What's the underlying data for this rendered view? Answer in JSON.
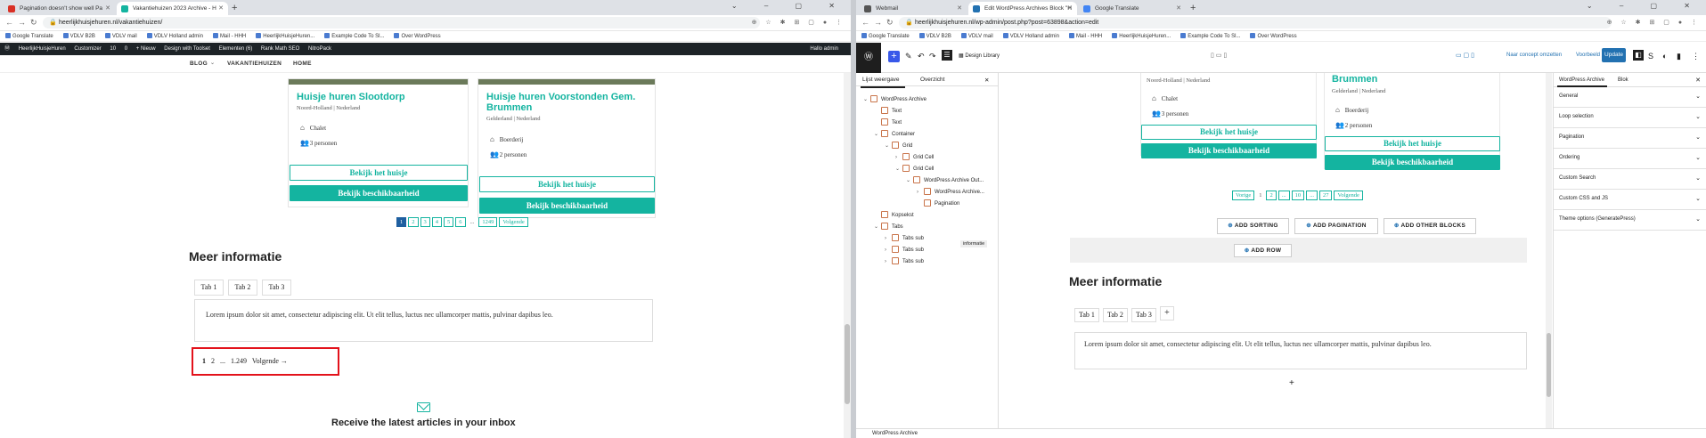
{
  "left": {
    "tabs": [
      {
        "title": "Pagination doesn't show well Pa",
        "color": "#d93025"
      },
      {
        "title": "Vakantiehuizen 2023 Archive - H",
        "color": "#14b4a0"
      }
    ],
    "url": "heerlijkhuisjehuren.nl/vakantiehuizen/",
    "bookmarks": [
      "Google Translate",
      "VDLV B2B",
      "VDLV mail",
      "VDLV Holland admin",
      "Mail - HHH",
      "HeerlijkHuisjeHuren...",
      "Example Code To Sl...",
      "Over WordPress"
    ],
    "adminbar": {
      "items": [
        "HeerlijkHuisjeHuren",
        "Customizer",
        "10",
        "0",
        "+ Nieuw",
        "Design with Toolset",
        "Elementen (6)",
        "Rank Math SEO",
        "NitroPack"
      ],
      "right": "Hallo admin"
    },
    "nav": {
      "blog": "BLOG",
      "vakantiehuizen": "VAKANTIEHUIZEN",
      "home": "HOME"
    },
    "cards": [
      {
        "title": "Huisje huren Slootdorp",
        "location": "Noord-Holland | Nederland",
        "type": "Chalet",
        "persons": "3 personen",
        "btn_house": "Bekijk het huisje",
        "btn_avail": "Bekijk beschikbaarheid"
      },
      {
        "title": "Huisje huren Voorstonden Gem. Brummen",
        "location": "Gelderland | Nederland",
        "type": "Boerderij",
        "persons": "2 personen",
        "btn_house": "Bekijk het huisje",
        "btn_avail": "Bekijk beschikbaarheid"
      }
    ],
    "pagination": [
      "1",
      "2",
      "3",
      "4",
      "5",
      "6",
      "...",
      "1249",
      "Volgende"
    ],
    "meer_info": "Meer informatie",
    "tab_labels": [
      "Tab 1",
      "Tab 2",
      "Tab 3"
    ],
    "lorem": "Lorem ipsum dolor sit amet, consectetur adipiscing elit. Ut elit tellus, luctus nec ullamcorper mattis, pulvinar dapibus leo.",
    "wp_pagination": [
      "1",
      "2",
      "...",
      "1.249",
      "Volgende →"
    ],
    "subscribe": "Receive the latest articles in your inbox"
  },
  "right": {
    "tabs": [
      {
        "title": "Webmail",
        "color": "#555"
      },
      {
        "title": "Edit WordPress Archives Block \"H",
        "color": "#2271b1"
      },
      {
        "title": "Google Translate",
        "color": "#4285f4"
      }
    ],
    "url": "heerlijkhuisjehuren.nl/wp-admin/post.php?post=63898&action=edit",
    "bookmarks": [
      "Google Translate",
      "VDLV B2B",
      "VDLV mail",
      "VDLV Holland admin",
      "Mail - HHH",
      "HeerlijkHuisjeHuren...",
      "Example Code To Sl...",
      "Over WordPress"
    ],
    "toolbar": {
      "design_library": "Design Library",
      "save_draft": "Naar concept omzetten",
      "preview": "Voorbeeld",
      "update": "Update"
    },
    "listview": {
      "tab1": "Lijst weergave",
      "tab2": "Overzicht",
      "rows": [
        {
          "label": "WordPress Archive",
          "indent": 0,
          "chev": "⌄"
        },
        {
          "label": "Text",
          "indent": 1,
          "chev": ""
        },
        {
          "label": "Text",
          "indent": 1,
          "chev": ""
        },
        {
          "label": "Container",
          "indent": 1,
          "chev": "⌄"
        },
        {
          "label": "Grid",
          "indent": 2,
          "chev": "⌄"
        },
        {
          "label": "Grid Cell",
          "indent": 3,
          "chev": "›"
        },
        {
          "label": "Grid Cell",
          "indent": 3,
          "chev": "⌄"
        },
        {
          "label": "WordPress Archive Out...",
          "indent": 4,
          "chev": "⌄"
        },
        {
          "label": "WordPress Archive...",
          "indent": 5,
          "chev": "›"
        },
        {
          "label": "Pagination",
          "indent": 5,
          "chev": ""
        },
        {
          "label": "Kopsekst",
          "indent": 1,
          "chev": ""
        },
        {
          "label": "Tabs",
          "indent": 1,
          "chev": "⌄"
        },
        {
          "label": "Tabs sub",
          "indent": 2,
          "chev": "›"
        },
        {
          "label": "Tabs sub",
          "indent": 2,
          "chev": "›"
        },
        {
          "label": "Tabs sub",
          "indent": 2,
          "chev": "›"
        }
      ],
      "kopsekst_badge": "informatie"
    },
    "canvas": {
      "cards": [
        {
          "location": "Noord-Holland | Nederland",
          "type": "Chalet",
          "persons": "3 personen",
          "btn_house": "Bekijk het huisje",
          "btn_avail": "Bekijk beschikbaarheid"
        },
        {
          "title": "Brummen",
          "location": "Gelderland | Nederland",
          "type": "Boerderij",
          "persons": "2 personen",
          "btn_house": "Bekijk het huisje",
          "btn_avail": "Bekijk beschikbaarheid"
        }
      ],
      "pagination": [
        "Vorige",
        "1",
        "2",
        "...",
        "10",
        "...",
        "27",
        "Volgende"
      ],
      "add_sorting": "ADD SORTING",
      "add_pagination": "ADD PAGINATION",
      "add_other": "ADD OTHER BLOCKS",
      "add_row": "ADD ROW",
      "meer_info": "Meer informatie",
      "tab_labels": [
        "Tab 1",
        "Tab 2",
        "Tab 3"
      ],
      "lorem": "Lorem ipsum dolor sit amet, consectetur adipiscing elit. Ut elit tellus, luctus nec ullamcorper mattis, pulvinar dapibus leo."
    },
    "inspector": {
      "tab1": "WordPress Archive",
      "tab2": "Blok",
      "sections": [
        "General",
        "Loop selection",
        "Pagination",
        "Ordering",
        "Custom Search",
        "Custom CSS and JS",
        "Theme options (GeneratePress)"
      ]
    },
    "status": "WordPress Archive"
  }
}
